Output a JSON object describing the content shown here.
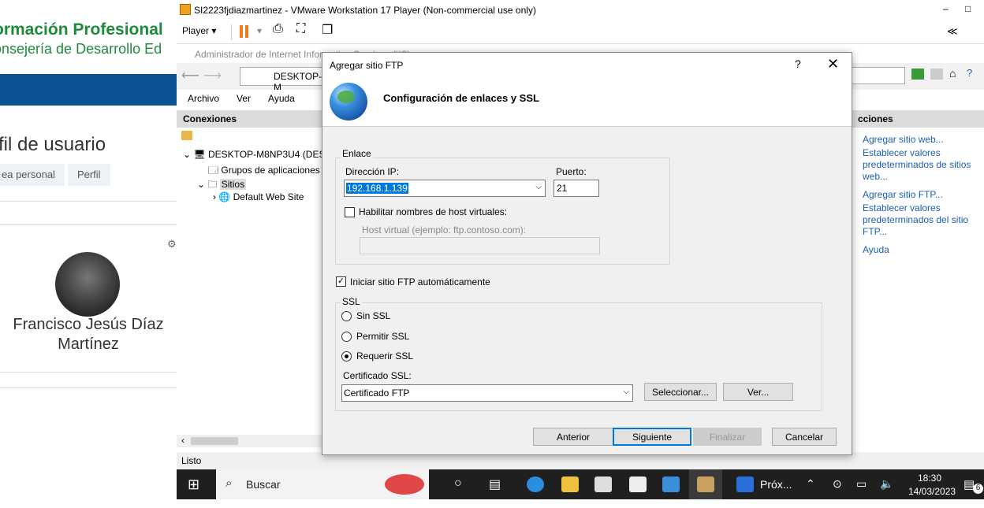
{
  "webpage": {
    "brand_title": "ormación Profesional",
    "brand_subtitle": "onsejería de Desarrollo Ed",
    "profile_title": "rfil de usuario",
    "breadcrumbs": [
      "ea personal",
      "Perfil"
    ],
    "user_name": "Francisco Jesús Díaz Martínez"
  },
  "vmware": {
    "window_title": "SI2223fjdiazmartinez - VMware Workstation 17 Player (Non-commercial use only)",
    "player_menu": "Player",
    "minimize": "–",
    "maximize": "□",
    "collapse": "≪"
  },
  "iis": {
    "window_title": "Administrador de Internet Information Services (IIS)",
    "address": "DESKTOP-M",
    "menu": [
      "Archivo",
      "Ver",
      "Ayuda"
    ],
    "connections_header": "Conexiones",
    "actions_header": "cciones",
    "tree": {
      "server": "DESKTOP-M8NP3U4 (DESK",
      "app_pools": "Grupos de aplicaciones",
      "sites": "Sitios",
      "default_site": "Default Web Site"
    },
    "actions": [
      "Agregar sitio web...",
      "Establecer valores predeterminados de sitios web...",
      "Agregar sitio FTP...",
      "Establecer valores predeterminados del sitio FTP...",
      "Ayuda"
    ],
    "status": "Listo"
  },
  "dialog": {
    "title": "Agregar sitio FTP",
    "help": "?",
    "close": "✕",
    "heading": "Configuración de enlaces y SSL",
    "binding_group": "Enlace",
    "ip_label": "Dirección IP:",
    "ip_value": "192.168.1.139",
    "port_label": "Puerto:",
    "port_value": "21",
    "virtual_host_check": "Habilitar nombres de host virtuales:",
    "virtual_host_label": "Host virtual (ejemplo: ftp.contoso.com):",
    "virtual_host_value": "",
    "autostart_check": "Iniciar sitio FTP automáticamente",
    "autostart_checked": true,
    "ssl_group": "SSL",
    "ssl_options": [
      "Sin SSL",
      "Permitir SSL",
      "Requerir SSL"
    ],
    "ssl_selected": "Requerir SSL",
    "cert_label": "Certificado SSL:",
    "cert_value": "Certificado FTP",
    "select_button": "Seleccionar...",
    "view_button": "Ver...",
    "buttons": {
      "back": "Anterior",
      "next": "Siguiente",
      "finish": "Finalizar",
      "cancel": "Cancelar"
    }
  },
  "taskbar": {
    "search_placeholder": "Buscar",
    "app_label": "Próx...",
    "time": "18:30",
    "date": "14/03/2023",
    "notification_count": "6"
  }
}
